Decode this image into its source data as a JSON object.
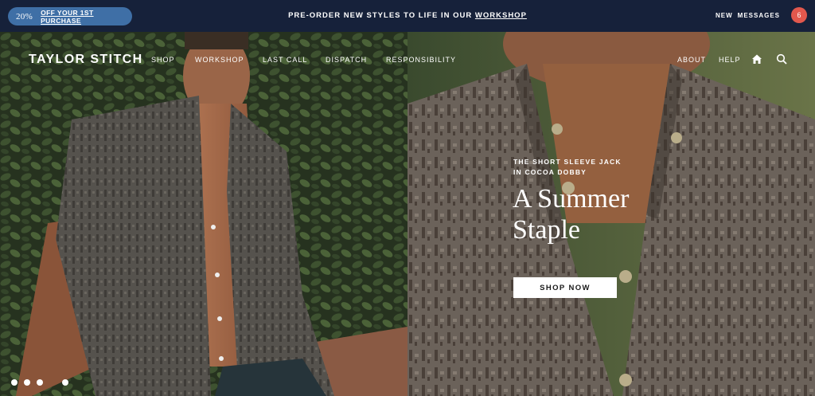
{
  "topbar": {
    "promo_pct": "20%",
    "promo_offer": "OFF YOUR 1ST PURCHASE",
    "announce_text": "PRE-ORDER NEW STYLES TO LIFE IN OUR ",
    "announce_link": "WORKSHOP",
    "messages_new": "NEW",
    "messages_label": "MESSAGES",
    "messages_count": "6"
  },
  "nav": {
    "logo": "TAYLOR STITCH",
    "links": [
      "SHOP",
      "WORKSHOP",
      "LAST CALL",
      "DISPATCH",
      "RESPONSIBILITY"
    ],
    "right_links": [
      "ABOUT",
      "HELP"
    ],
    "icons": [
      "home-icon",
      "search-icon"
    ]
  },
  "hero": {
    "kicker_line1": "THE SHORT SLEEVE JACK",
    "kicker_line2": "IN COCOA DOBBY",
    "headline_line1": "A Summer",
    "headline_line2": "Staple",
    "cta": "SHOP NOW"
  },
  "colors": {
    "topbar": "#16213a",
    "promo": "#3f6fa6",
    "badge": "#e2584d",
    "foliage": "#2a3526",
    "shirt": "#5a5048"
  }
}
